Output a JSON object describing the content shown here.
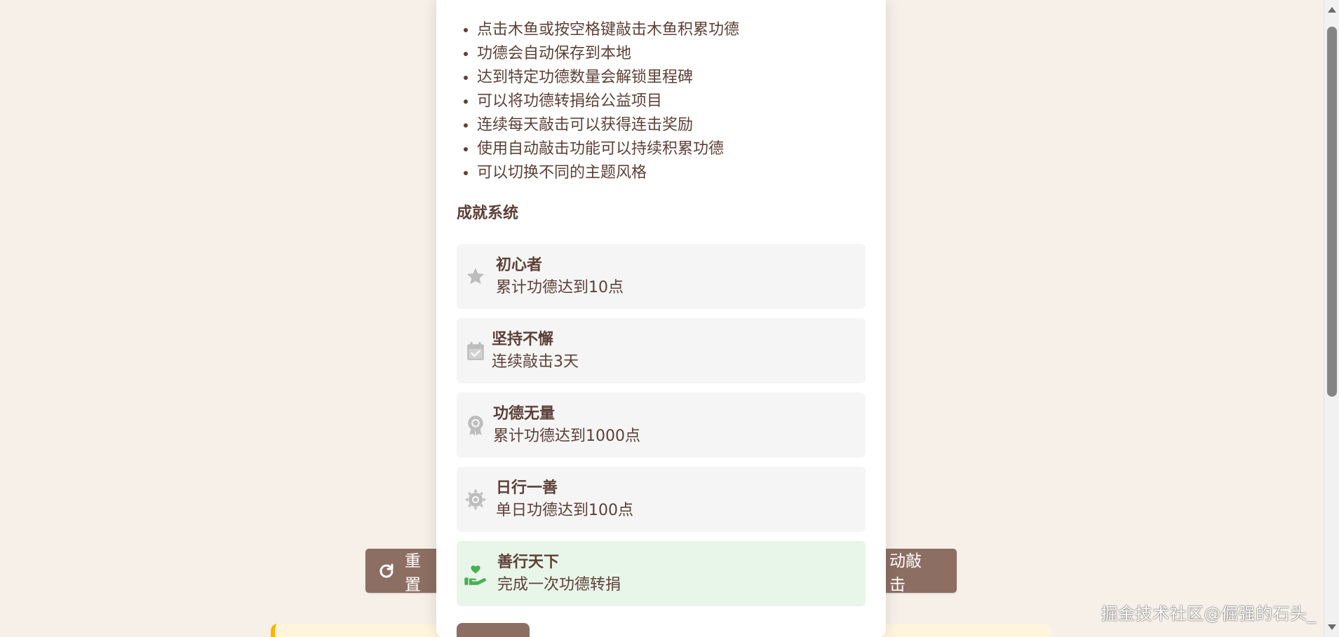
{
  "background": {
    "reset_button_label": "重置",
    "auto_button_label": "动敲击",
    "watermark_text": "掘金技术社区@倔强的石头_"
  },
  "modal": {
    "rules": [
      "点击木鱼或按空格键敲击木鱼积累功德",
      "功德会自动保存到本地",
      "达到特定功德数量会解锁里程碑",
      "可以将功德转捐给公益项目",
      "连续每天敲击可以获得连击奖励",
      "使用自动敲击功能可以持续积累功德",
      "可以切换不同的主题风格"
    ],
    "achievements_title": "成就系统",
    "achievements": [
      {
        "icon": "star-icon",
        "name": "初心者",
        "desc": "累计功德达到10点",
        "status": "locked"
      },
      {
        "icon": "calendar-check-icon",
        "name": "坚持不懈",
        "desc": "连续敲击3天",
        "status": "locked"
      },
      {
        "icon": "award-icon",
        "name": "功德无量",
        "desc": "累计功德达到1000点",
        "status": "locked"
      },
      {
        "icon": "sun-icon",
        "name": "日行一善",
        "desc": "单日功德达到100点",
        "status": "locked"
      },
      {
        "icon": "hand-holding-heart-icon",
        "name": "善行天下",
        "desc": "完成一次功德转捐",
        "status": "unlocked"
      }
    ]
  },
  "colors": {
    "page_bg": "#f6f0e9",
    "text_brown": "#5d4037",
    "button_brown": "#8d6e63",
    "locked_icon": "#bdbdbd",
    "unlocked_icon": "#4caf50",
    "locked_card": "#f5f5f5",
    "unlocked_card": "#e8f5e9"
  }
}
